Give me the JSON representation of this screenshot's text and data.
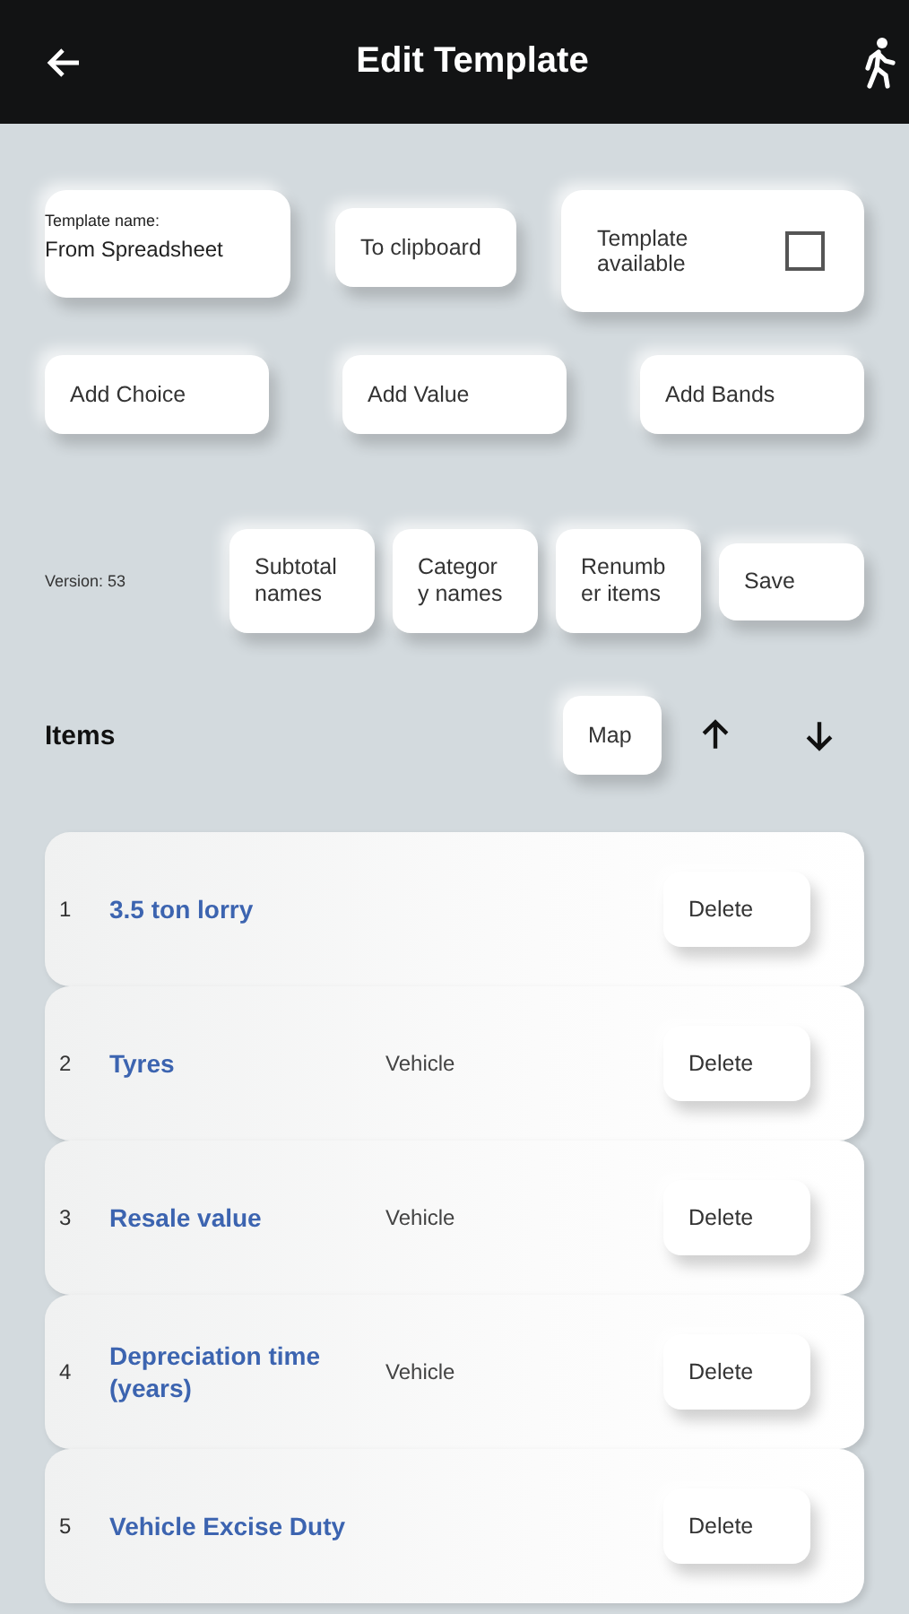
{
  "header": {
    "title": "Edit Template"
  },
  "template_name": {
    "label": "Template name:",
    "value": "From Spreadsheet"
  },
  "clipboard_button": "To clipboard",
  "template_available": {
    "label": "Template available",
    "checked": false
  },
  "add_buttons": [
    "Add Choice",
    "Add Value",
    "Add Bands"
  ],
  "version": "Version: 53",
  "action_buttons": [
    "Subtotal names",
    "Categor y names",
    "Renumb er items",
    "Save"
  ],
  "items_heading": "Items",
  "map_button": "Map",
  "items": [
    {
      "number": "1",
      "name": "3.5 ton lorry",
      "delete": "Delete"
    },
    {
      "number": "2",
      "name": "Tyres",
      "category": "Vehicle",
      "delete": "Delete"
    },
    {
      "number": "3",
      "name": "Resale value",
      "category": "Vehicle",
      "delete": "Delete"
    },
    {
      "number": "4",
      "name": "Depreciation time (years)",
      "category": "Vehicle",
      "delete": "Delete"
    },
    {
      "number": "5",
      "name": "Vehicle Excise Duty",
      "delete": "Delete"
    }
  ]
}
